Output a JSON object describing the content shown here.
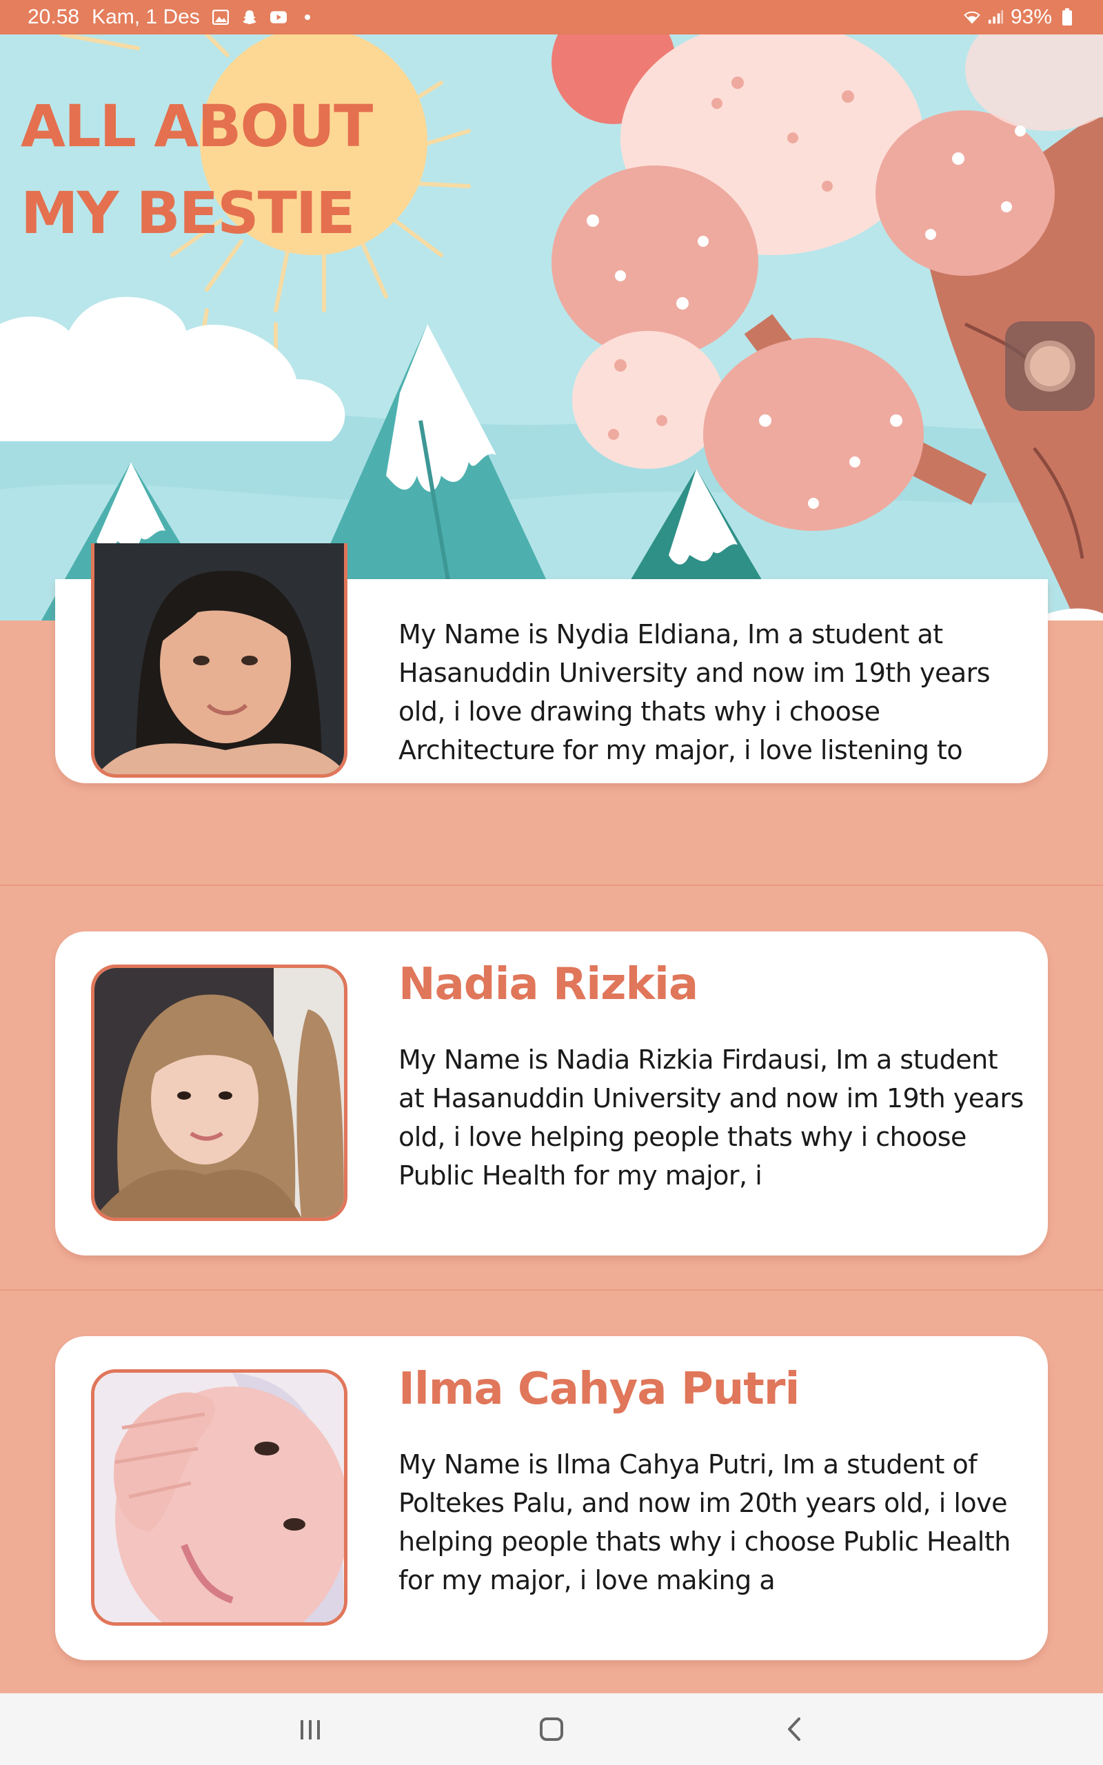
{
  "status_bar": {
    "time": "20.58",
    "date": "Kam, 1 Des",
    "notification_icons": [
      "gallery-icon",
      "snapchat-icon",
      "youtube-icon",
      "dot-icon"
    ],
    "battery": "93%"
  },
  "hero": {
    "title_line1": "ALL ABOUT",
    "title_line2": "MY BESTIE"
  },
  "profiles": [
    {
      "name": "",
      "bio": "My Name is Nydia Eldiana, Im a student at Hasanuddin University and now im 19th years old, i love drawing thats why i choose Architecture for my major, i love listening to"
    },
    {
      "name": "Nadia Rizkia",
      "bio": "My Name is Nadia Rizkia Firdausi, Im a student at Hasanuddin University and now im 19th years old, i love helping people thats why i choose Public Health for my major, i"
    },
    {
      "name": "Ilma Cahya Putri",
      "bio": "My Name is Ilma Cahya Putri, Im a student of Poltekes Palu, and now im 20th years old, i love helping people thats why i choose Public Health for my major, i love making a"
    }
  ],
  "colors": {
    "accent": "#e0765a",
    "status_bar": "#e47e5c",
    "background": "#f0ad96",
    "sky": "#b9e6ea"
  },
  "nav_bar": {
    "icons": [
      "recent-apps-icon",
      "home-icon",
      "back-icon"
    ]
  }
}
